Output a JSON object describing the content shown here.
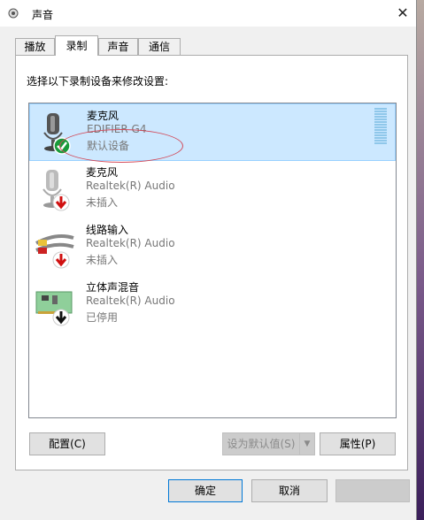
{
  "window": {
    "title": "声音",
    "close_glyph": "✕"
  },
  "tabs": [
    {
      "label": "播放",
      "active": false
    },
    {
      "label": "录制",
      "active": true
    },
    {
      "label": "声音",
      "active": false
    },
    {
      "label": "通信",
      "active": false
    }
  ],
  "panel": {
    "instruction": "选择以下录制设备来修改设置:"
  },
  "devices": [
    {
      "name": "麦克风",
      "sub": "EDIFIER G4",
      "status": "默认设备",
      "icon": "microphone-icon",
      "badge": "check-badge-icon",
      "selected": true
    },
    {
      "name": "麦克风",
      "sub": "Realtek(R) Audio",
      "status": "未插入",
      "icon": "microphone-icon",
      "badge": "red-down-arrow-icon",
      "selected": false
    },
    {
      "name": "线路输入",
      "sub": "Realtek(R) Audio",
      "status": "未插入",
      "icon": "line-in-cable-icon",
      "badge": "red-down-arrow-icon",
      "selected": false
    },
    {
      "name": "立体声混音",
      "sub": "Realtek(R) Audio",
      "status": "已停用",
      "icon": "sound-card-icon",
      "badge": "black-down-arrow-icon",
      "selected": false
    }
  ],
  "buttons": {
    "configure": "配置(C)",
    "set_default": "设为默认值(S)",
    "properties": "属性(P)",
    "ok": "确定",
    "cancel": "取消"
  },
  "colors": {
    "selection": "#cce8ff",
    "annotation": "#d24a5a",
    "level_meter": "#8fc7ea"
  }
}
